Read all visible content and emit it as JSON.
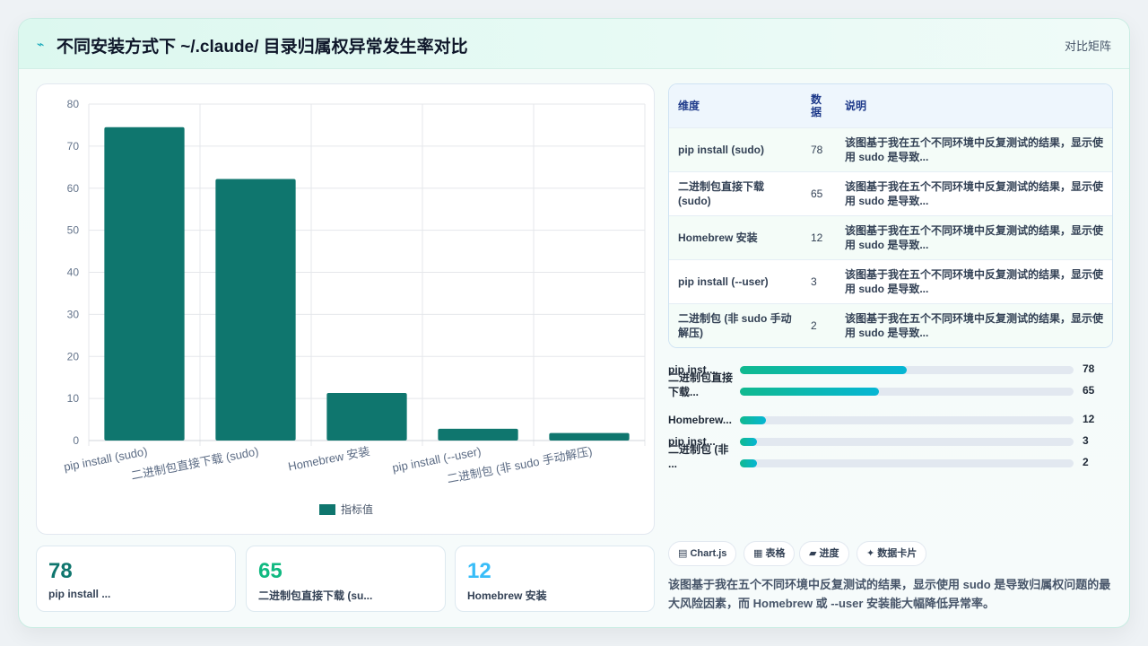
{
  "header": {
    "icon": "sparkle-icon",
    "title": "不同安装方式下 ~/.claude/ 目录归属权异常发生率对比",
    "right_link": "对比矩阵"
  },
  "chart_data": {
    "type": "bar",
    "categories": [
      "pip install (sudo)",
      "二进制包直接下载 (sudo)",
      "Homebrew 安装",
      "pip install (--user)",
      "二进制包 (非 sudo 手动解压)"
    ],
    "series": [
      {
        "name": "指标值",
        "values": [
          74.5,
          62.2,
          11.3,
          2.8,
          1.8
        ]
      }
    ],
    "ylim": [
      0,
      80
    ],
    "yticks": [
      0,
      10,
      20,
      30,
      40,
      50,
      60,
      70,
      80
    ],
    "legend": "bottom-center",
    "grid": true,
    "bar_color": "#0f766e"
  },
  "table": {
    "headers": [
      "维度",
      "数据",
      "说明"
    ],
    "rows": [
      {
        "dim": "pip install (sudo)",
        "val": "78",
        "desc": "该图基于我在五个不同环境中反复测试的结果，显示使用 sudo 是导致..."
      },
      {
        "dim": "二进制包直接下载 (sudo)",
        "val": "65",
        "desc": "该图基于我在五个不同环境中反复测试的结果，显示使用 sudo 是导致..."
      },
      {
        "dim": "Homebrew 安装",
        "val": "12",
        "desc": "该图基于我在五个不同环境中反复测试的结果，显示使用 sudo 是导致..."
      },
      {
        "dim": "pip install (--user)",
        "val": "3",
        "desc": "该图基于我在五个不同环境中反复测试的结果，显示使用 sudo 是导致..."
      },
      {
        "dim": "二进制包 (非 sudo 手动解压)",
        "val": "2",
        "desc": "该图基于我在五个不同环境中反复测试的结果，显示使用 sudo 是导致..."
      }
    ]
  },
  "progress": [
    {
      "label": "pip inst...",
      "value": "78",
      "fraction": 0.5
    },
    {
      "label": "二进制包直接下载...",
      "value": "65",
      "fraction": 0.417
    },
    {
      "label": "Homebrew...",
      "value": "12",
      "fraction": 0.077
    },
    {
      "label": "pip inst...",
      "value": "3",
      "fraction": 0.05
    },
    {
      "label": "二进制包 (非 ...",
      "value": "2",
      "fraction": 0.05
    }
  ],
  "stats": [
    {
      "value": "78",
      "label": "pip install ...",
      "color": "#0f766e"
    },
    {
      "value": "65",
      "label": "二进制包直接下载 (su...",
      "color": "#10b981"
    },
    {
      "value": "12",
      "label": "Homebrew 安装",
      "color": "#38bdf8"
    }
  ],
  "chips": [
    {
      "icon": "chart-icon",
      "glyph": "▤",
      "label": "Chart.js"
    },
    {
      "icon": "table-icon",
      "glyph": "▦",
      "label": "表格"
    },
    {
      "icon": "progress-icon",
      "glyph": "▰",
      "label": "进度"
    },
    {
      "icon": "sparkle-icon",
      "glyph": "✦",
      "label": "数据卡片"
    }
  ],
  "summary": "该图基于我在五个不同环境中反复测试的结果，显示使用 sudo 是导致归属权问题的最大风险因素，而 Homebrew 或 --user 安装能大幅降低异常率。"
}
